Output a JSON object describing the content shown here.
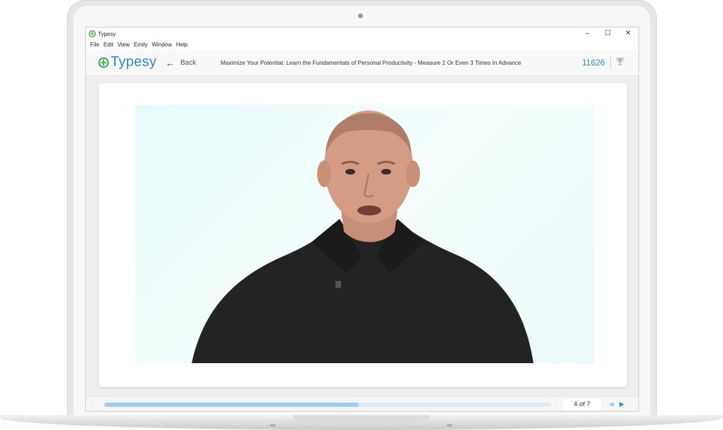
{
  "window": {
    "title": "Typesy",
    "controls": {
      "minimize": "–",
      "maximize": "☐",
      "close": "✕"
    }
  },
  "menu": [
    "File",
    "Edit",
    "View",
    "Emily",
    "Window",
    "Help"
  ],
  "header": {
    "logo_text": "Typesy",
    "back_label": "Back",
    "course_title": "Maximize Your Potential: Learn the Fundamentals of Personal Productivity - Measure 2 Or Even 3 Times In Advance",
    "score": "11626",
    "trophy_icon": "trophy-icon"
  },
  "footer": {
    "progress_fraction": 0.57,
    "page_indicator": "4 of 7",
    "prev_icon": "◀",
    "next_icon": "▶"
  },
  "colors": {
    "brand_blue": "#2a8ad6",
    "brand_green": "#3aa84f",
    "progress": "#9fcdee"
  }
}
